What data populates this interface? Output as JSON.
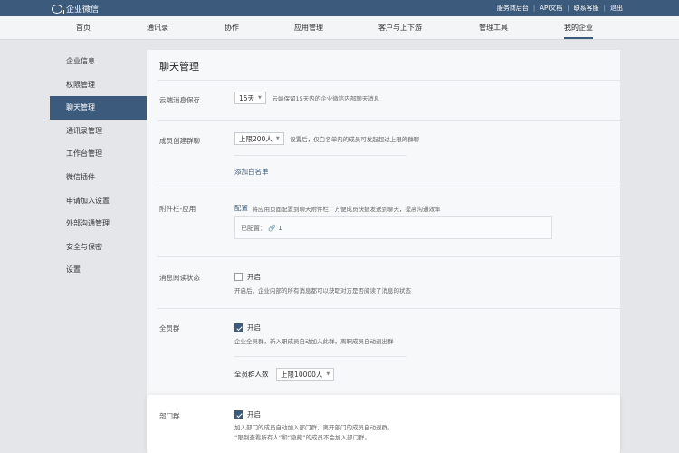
{
  "topbar": {
    "app_title": "企业微信",
    "links": [
      "服务商后台",
      "API文档",
      "联系客服",
      "退出"
    ]
  },
  "nav": {
    "items": [
      "首页",
      "通讯录",
      "协作",
      "应用管理",
      "客户与上下游",
      "管理工具",
      "我的企业"
    ],
    "active": "我的企业"
  },
  "sidebar": {
    "items": [
      "企业信息",
      "权限管理",
      "聊天管理",
      "通讯录管理",
      "工作台管理",
      "微信插件",
      "申请加入设置",
      "外部沟通管理",
      "安全与保密",
      "设置"
    ],
    "active": "聊天管理"
  },
  "main": {
    "title": "聊天管理",
    "cloud_save": {
      "label": "云端消息保存",
      "select_value": "15天",
      "hint": "云端保留15天内的企业微信内部聊天消息"
    },
    "group_create": {
      "label": "成员创建群聊",
      "select_value": "上限200人",
      "hint": "设置后，仅白名单内的成员可发起超过上限的群聊",
      "add_whitelist": "添加白名单"
    },
    "attachment": {
      "label": "附件栏-应用",
      "config_link": "配置",
      "hint": "将应用页面配置到聊天附件栏，方便成员快捷发送到聊天，提高沟通效率",
      "configured_label": "已配置：",
      "configured_count": "1"
    },
    "read_status": {
      "label": "消息阅读状态",
      "checkbox_label": "开启",
      "checked": false,
      "hint": "开启后，企业内部的所有消息都可以获取对方是否阅读了消息的状态"
    },
    "all_staff_group": {
      "label": "全员群",
      "checkbox_label": "开启",
      "checked": true,
      "hint": "企业全员群，新入职成员自动加入此群，离职成员自动退出群",
      "count_label": "全员群人数",
      "count_select": "上限10000人"
    },
    "dept_group": {
      "label": "部门群",
      "checkbox_label": "开启",
      "checked": true,
      "hint_line1": "加入部门的成员自动加入部门群，离开部门的成员自动退群。",
      "hint_line2": "“限制查看所有人”和“隐藏”的成员不会加入部门群。"
    }
  },
  "colors": {
    "brand": "#3b5a7c",
    "page_bg": "#e4e6e9"
  }
}
